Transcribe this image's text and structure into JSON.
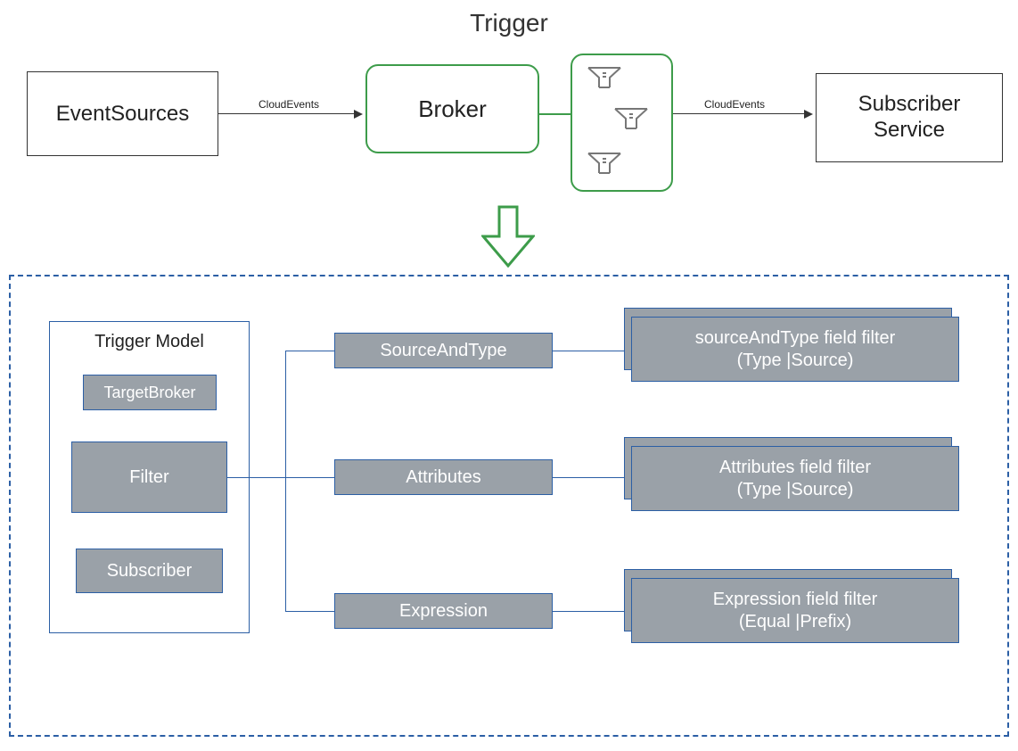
{
  "title": "Trigger",
  "top": {
    "eventSources": "EventSources",
    "arrow1Label": "CloudEvents",
    "broker": "Broker",
    "arrow2Label": "CloudEvents",
    "subscriber_line1": "Subscriber",
    "subscriber_line2": "Service"
  },
  "model": {
    "panelTitle": "Trigger Model",
    "items": {
      "targetBroker": "TargetBroker",
      "filter": "Filter",
      "subscriber": "Subscriber"
    },
    "filterTypes": {
      "sourceAndType": {
        "label": "SourceAndType",
        "detail_line1": "sourceAndType field filter",
        "detail_line2": "(Type |Source)"
      },
      "attributes": {
        "label": "Attributes",
        "detail_line1": "Attributes field filter",
        "detail_line2": "(Type |Source)"
      },
      "expression": {
        "label": "Expression",
        "detail_line1": "Expression field filter",
        "detail_line2": "(Equal |Prefix)"
      }
    }
  }
}
